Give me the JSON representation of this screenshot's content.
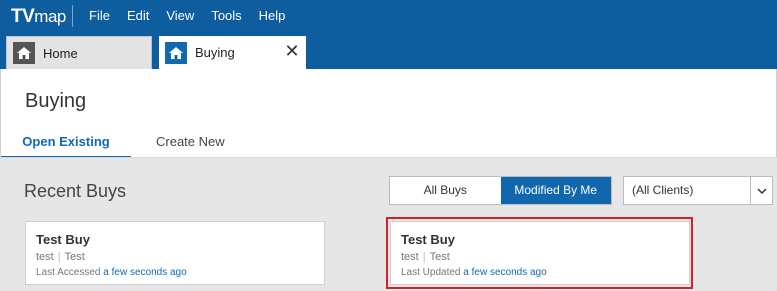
{
  "app": {
    "logo_tv": "TV",
    "logo_map": "map"
  },
  "menu": [
    "File",
    "Edit",
    "View",
    "Tools",
    "Help"
  ],
  "tabs": [
    {
      "label": "Home",
      "icon": "home-icon"
    },
    {
      "label": "Buying",
      "icon": "home-icon",
      "close": "✕"
    }
  ],
  "page": {
    "title": "Buying"
  },
  "subtabs": {
    "open_existing": "Open Existing",
    "create_new": "Create New"
  },
  "recent": {
    "title": "Recent Buys",
    "toggle": {
      "all": "All Buys",
      "modified": "Modified By Me",
      "active": "modified"
    },
    "client_select": "(All Clients)"
  },
  "cards": [
    {
      "name": "Test Buy",
      "meta_a": "test",
      "meta_b": "Test",
      "time_label": "Last Accessed",
      "time_value": "a few seconds ago"
    },
    {
      "name": "Test Buy",
      "meta_a": "test",
      "meta_b": "Test",
      "time_label": "Last Updated",
      "time_value": "a few seconds ago"
    }
  ],
  "colors": {
    "titlebar": "#0e5d9e",
    "accent": "#1269b0",
    "highlight": "#d9202a"
  }
}
